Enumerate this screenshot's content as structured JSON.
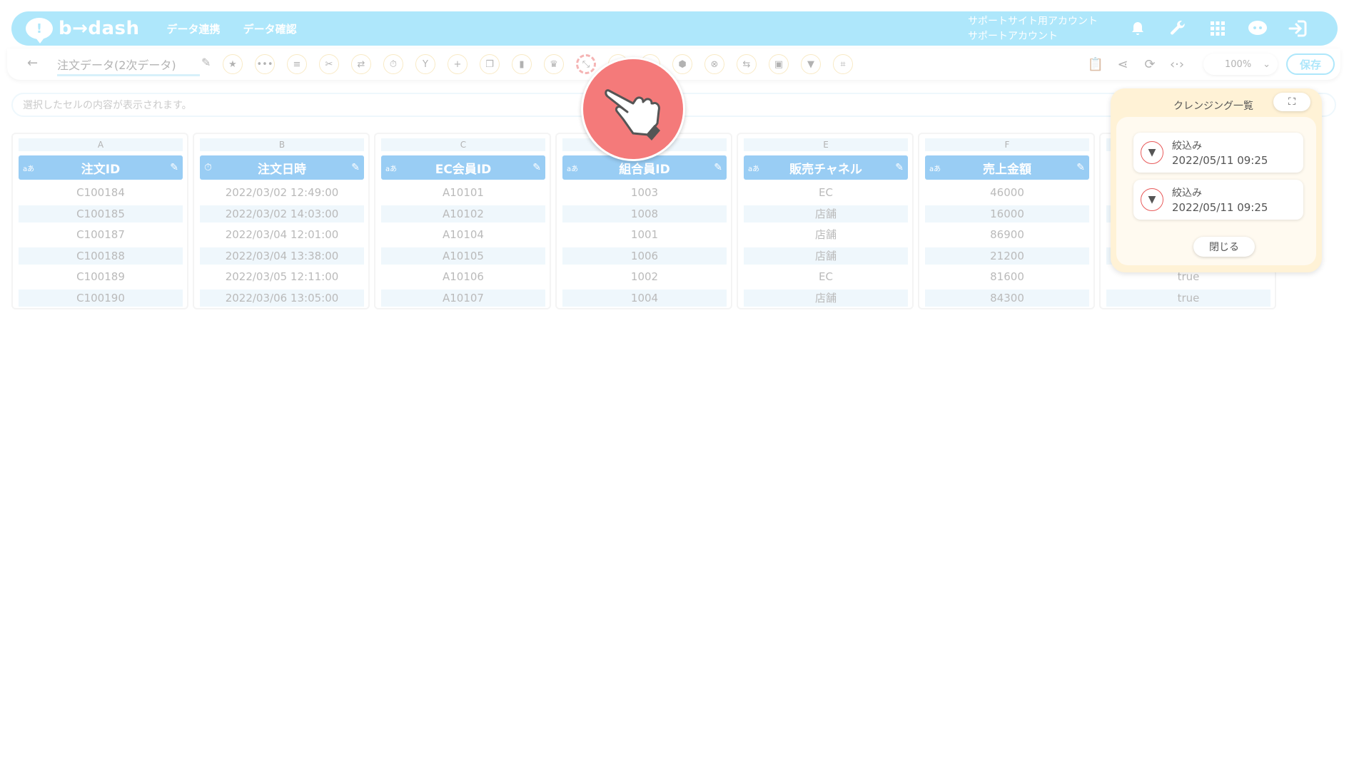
{
  "app": {
    "logo_text": "b→dash",
    "nav": [
      "データ連携",
      "データ確認"
    ],
    "account_line1": "サポートサイト用アカウント",
    "account_line2": "サポートアカウント"
  },
  "toolbar": {
    "title": "注文データ(2次データ)",
    "zoom": "100%",
    "save_label": "保存"
  },
  "cellbar": {
    "placeholder": "選択したセルの内容が表示されます。"
  },
  "columns": [
    {
      "letter": "A",
      "type": "aあ",
      "name": "注文ID",
      "cells": [
        "C100184",
        "C100185",
        "C100187",
        "C100188",
        "C100189",
        "C100190"
      ]
    },
    {
      "letter": "B",
      "type": "clock",
      "name": "注文日時",
      "cells": [
        "2022/03/02 12:49:00",
        "2022/03/02 14:03:00",
        "2022/03/04 12:01:00",
        "2022/03/04 13:38:00",
        "2022/03/05 12:11:00",
        "2022/03/06 13:05:00"
      ]
    },
    {
      "letter": "C",
      "type": "aあ",
      "name": "EC会員ID",
      "cells": [
        "A10101",
        "A10102",
        "A10104",
        "A10105",
        "A10106",
        "A10107"
      ]
    },
    {
      "letter": "",
      "type": "aあ",
      "name": "組合員ID",
      "cells": [
        "1003",
        "1008",
        "1001",
        "1006",
        "1002",
        "1004"
      ]
    },
    {
      "letter": "E",
      "type": "aあ",
      "name": "販売チャネル",
      "cells": [
        "EC",
        "店舗",
        "店舗",
        "店舗",
        "EC",
        "店舗"
      ]
    },
    {
      "letter": "F",
      "type": "aあ",
      "name": "売上金額",
      "cells": [
        "46000",
        "16000",
        "86900",
        "21200",
        "81600",
        "84300"
      ]
    },
    {
      "letter": "",
      "type": "",
      "name": "",
      "cells": [
        "",
        "",
        "",
        "",
        "true",
        "true"
      ]
    }
  ],
  "panel": {
    "title": "クレンジング一覧",
    "items": [
      {
        "name": "絞込み",
        "date": "2022/05/11 09:25"
      },
      {
        "name": "絞込み",
        "date": "2022/05/11 09:25"
      }
    ],
    "close_label": "閉じる"
  }
}
